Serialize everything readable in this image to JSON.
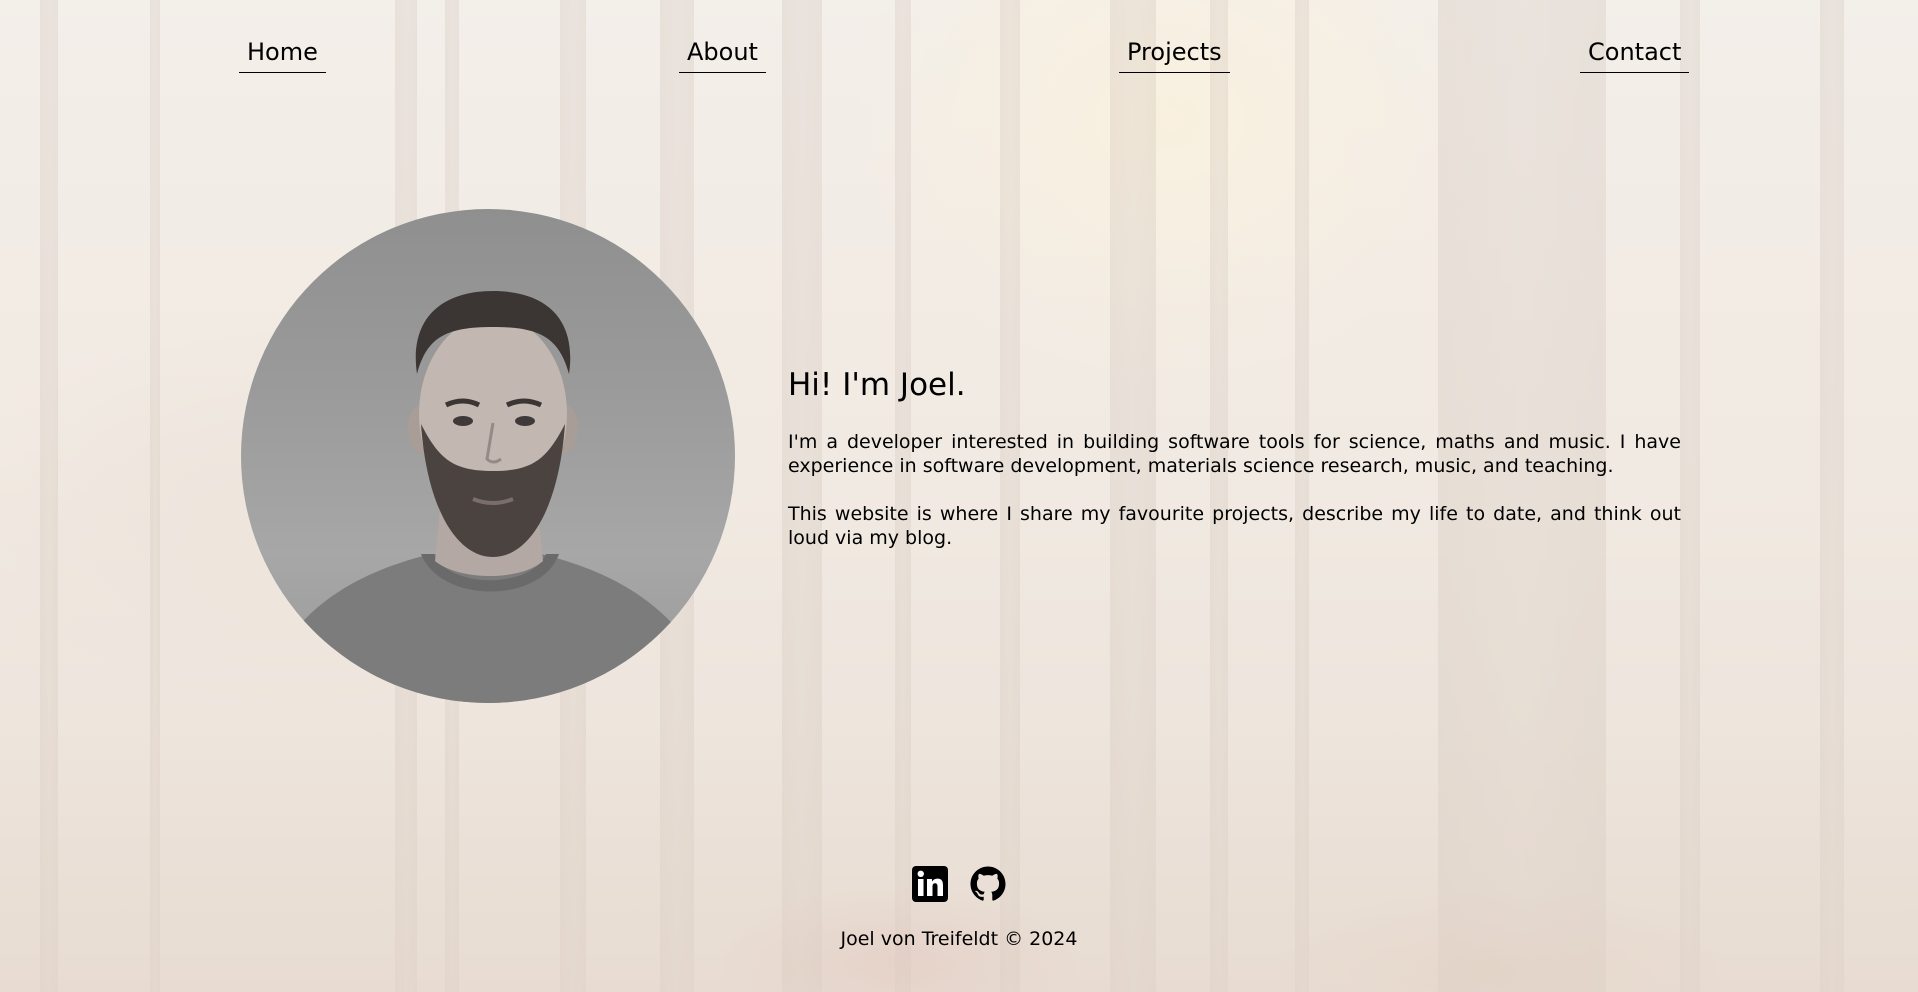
{
  "nav": {
    "items": [
      {
        "label": "Home"
      },
      {
        "label": "About"
      },
      {
        "label": "Projects"
      },
      {
        "label": "Contact"
      }
    ]
  },
  "hero": {
    "heading": "Hi! I'm Joel.",
    "paragraphs": [
      "I'm a developer interested in building software tools for science, maths and music. I have experience in software development, materials science research, music, and teaching.",
      "This website is where I share my favourite projects, describe my life to date, and think out loud via my blog."
    ]
  },
  "footer": {
    "social": [
      {
        "icon": "linkedin-icon"
      },
      {
        "icon": "github-icon"
      }
    ],
    "copyright": "Joel von Treifeldt © 2024"
  },
  "colors": {
    "text": "#000000",
    "background": "#efe7df"
  }
}
